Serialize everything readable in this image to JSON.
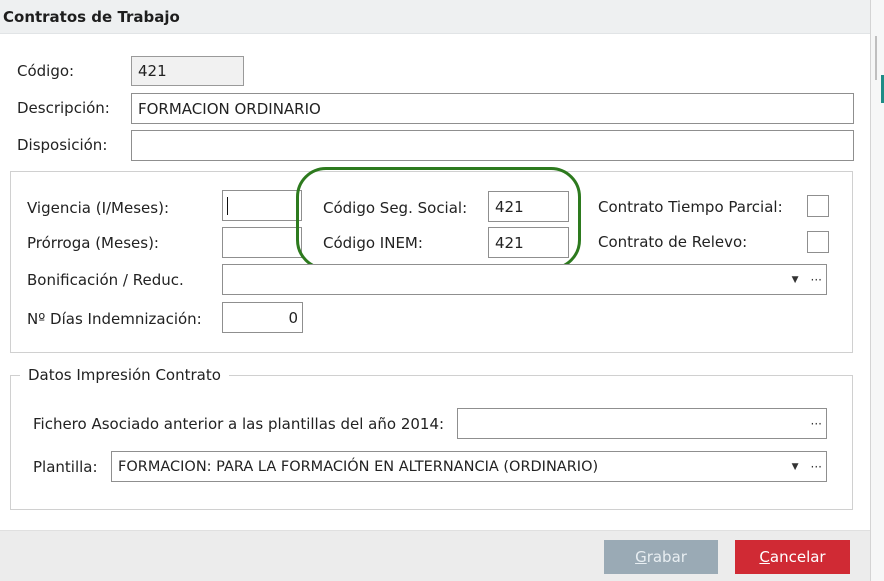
{
  "window": {
    "title": "Contratos de Trabajo"
  },
  "fields": {
    "codigo": {
      "label": "Código:",
      "value": "421"
    },
    "descripcion": {
      "label": "Descripción:",
      "value": "FORMACION ORDINARIO"
    },
    "disposicion": {
      "label": "Disposición:",
      "value": ""
    }
  },
  "contract_panel": {
    "vigencia": {
      "label": "Vigencia (I/Meses):",
      "value": ""
    },
    "prorroga": {
      "label": "Prórroga (Meses):",
      "value": ""
    },
    "codigo_seg_social": {
      "label": "Código Seg. Social:",
      "value": "421"
    },
    "codigo_inem": {
      "label": "Código INEM:",
      "value": "421"
    },
    "tiempo_parcial": {
      "label": "Contrato Tiempo Parcial:",
      "checked": false
    },
    "relevo": {
      "label": "Contrato de Relevo:",
      "checked": false
    },
    "bonificacion": {
      "label": "Bonificación / Reduc.",
      "value": ""
    },
    "dias_indemnizacion": {
      "label": "Nº Días Indemnización:",
      "value": "0"
    }
  },
  "print_panel": {
    "legend": "Datos Impresión Contrato",
    "fichero": {
      "label": "Fichero Asociado anterior a las plantillas del año 2014:",
      "value": ""
    },
    "plantilla": {
      "label": "Plantilla:",
      "value": "FORMACION: PARA LA FORMACIÓN EN ALTERNANCIA (ORDINARIO)"
    }
  },
  "buttons": {
    "grabar": {
      "label": "Grabar",
      "accel": "G",
      "rest": "rabar"
    },
    "cancelar": {
      "label": "Cancelar",
      "accel": "C",
      "rest": "ancelar"
    }
  },
  "icons": {
    "ellipsis": "···",
    "dropdown": "▼"
  },
  "colors": {
    "highlight": "#2d7a1e",
    "cancel": "#d02a34",
    "save_disabled": "#9aaab5",
    "accent": "#1e8c86"
  }
}
